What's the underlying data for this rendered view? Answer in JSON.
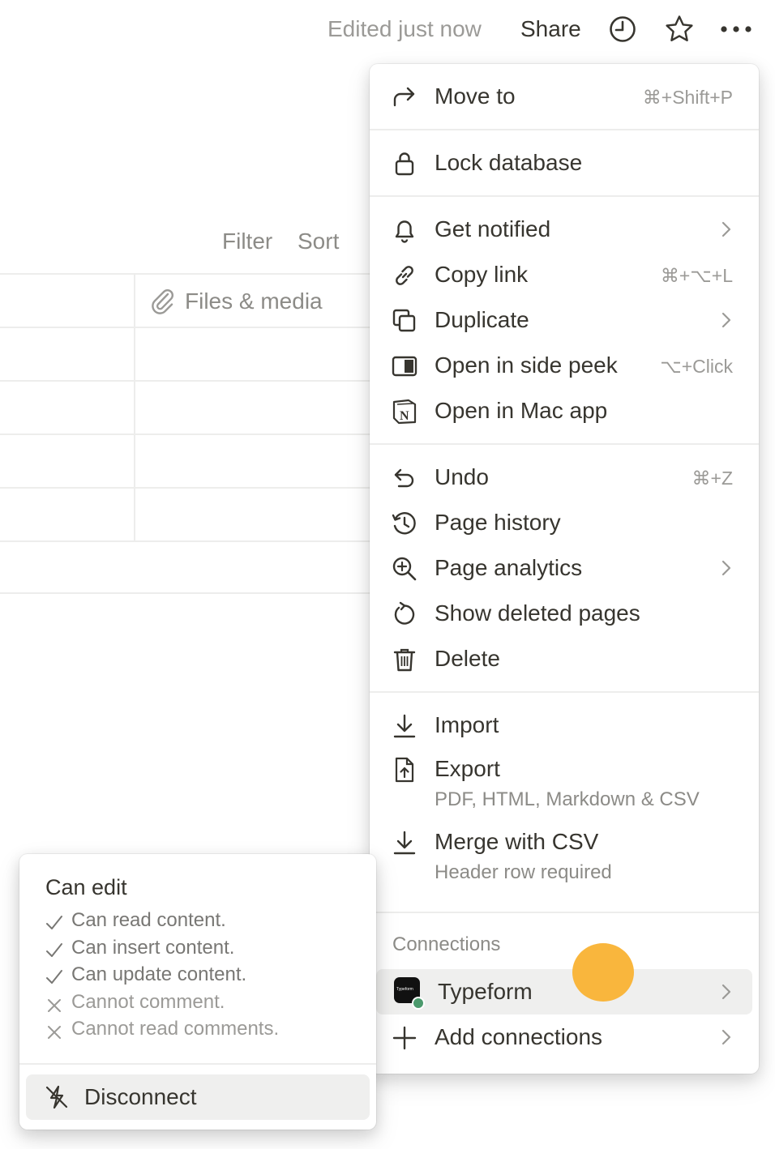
{
  "topbar": {
    "edited": "Edited just now",
    "share": "Share",
    "icons": [
      "clock-icon",
      "star-icon",
      "more-icon"
    ]
  },
  "database": {
    "filter": "Filter",
    "sort": "Sort",
    "column": "Files & media"
  },
  "menu": {
    "move_to": {
      "label": "Move to",
      "shortcut": "⌘+Shift+P"
    },
    "lock": {
      "label": "Lock database"
    },
    "get_notified": {
      "label": "Get notified"
    },
    "copy_link": {
      "label": "Copy link",
      "shortcut": "⌘+⌥+L"
    },
    "duplicate": {
      "label": "Duplicate"
    },
    "side_peek": {
      "label": "Open in side peek",
      "shortcut": "⌥+Click"
    },
    "mac_app": {
      "label": "Open in Mac app"
    },
    "undo": {
      "label": "Undo",
      "shortcut": "⌘+Z"
    },
    "page_history": {
      "label": "Page history"
    },
    "page_analytics": {
      "label": "Page analytics"
    },
    "show_deleted": {
      "label": "Show deleted pages"
    },
    "delete": {
      "label": "Delete"
    },
    "import": {
      "label": "Import"
    },
    "export": {
      "label": "Export",
      "sub": "PDF, HTML, Markdown & CSV"
    },
    "merge": {
      "label": "Merge with CSV",
      "sub": "Header row required"
    },
    "connections_title": "Connections",
    "typeform": {
      "label": "Typeform",
      "logo_text": "Typeform"
    },
    "add_connections": {
      "label": "Add connections"
    }
  },
  "permissions": {
    "title": "Can edit",
    "items": [
      {
        "text": "Can read content.",
        "allowed": true
      },
      {
        "text": "Can insert content.",
        "allowed": true
      },
      {
        "text": "Can update content.",
        "allowed": true
      },
      {
        "text": "Cannot comment.",
        "allowed": false
      },
      {
        "text": "Cannot read comments.",
        "allowed": false
      }
    ],
    "disconnect": "Disconnect"
  },
  "colors": {
    "accent_cursor": "#f9b233",
    "text": "#37352f",
    "muted": "#9b9a97",
    "connection_status": "#4c9a6d"
  }
}
